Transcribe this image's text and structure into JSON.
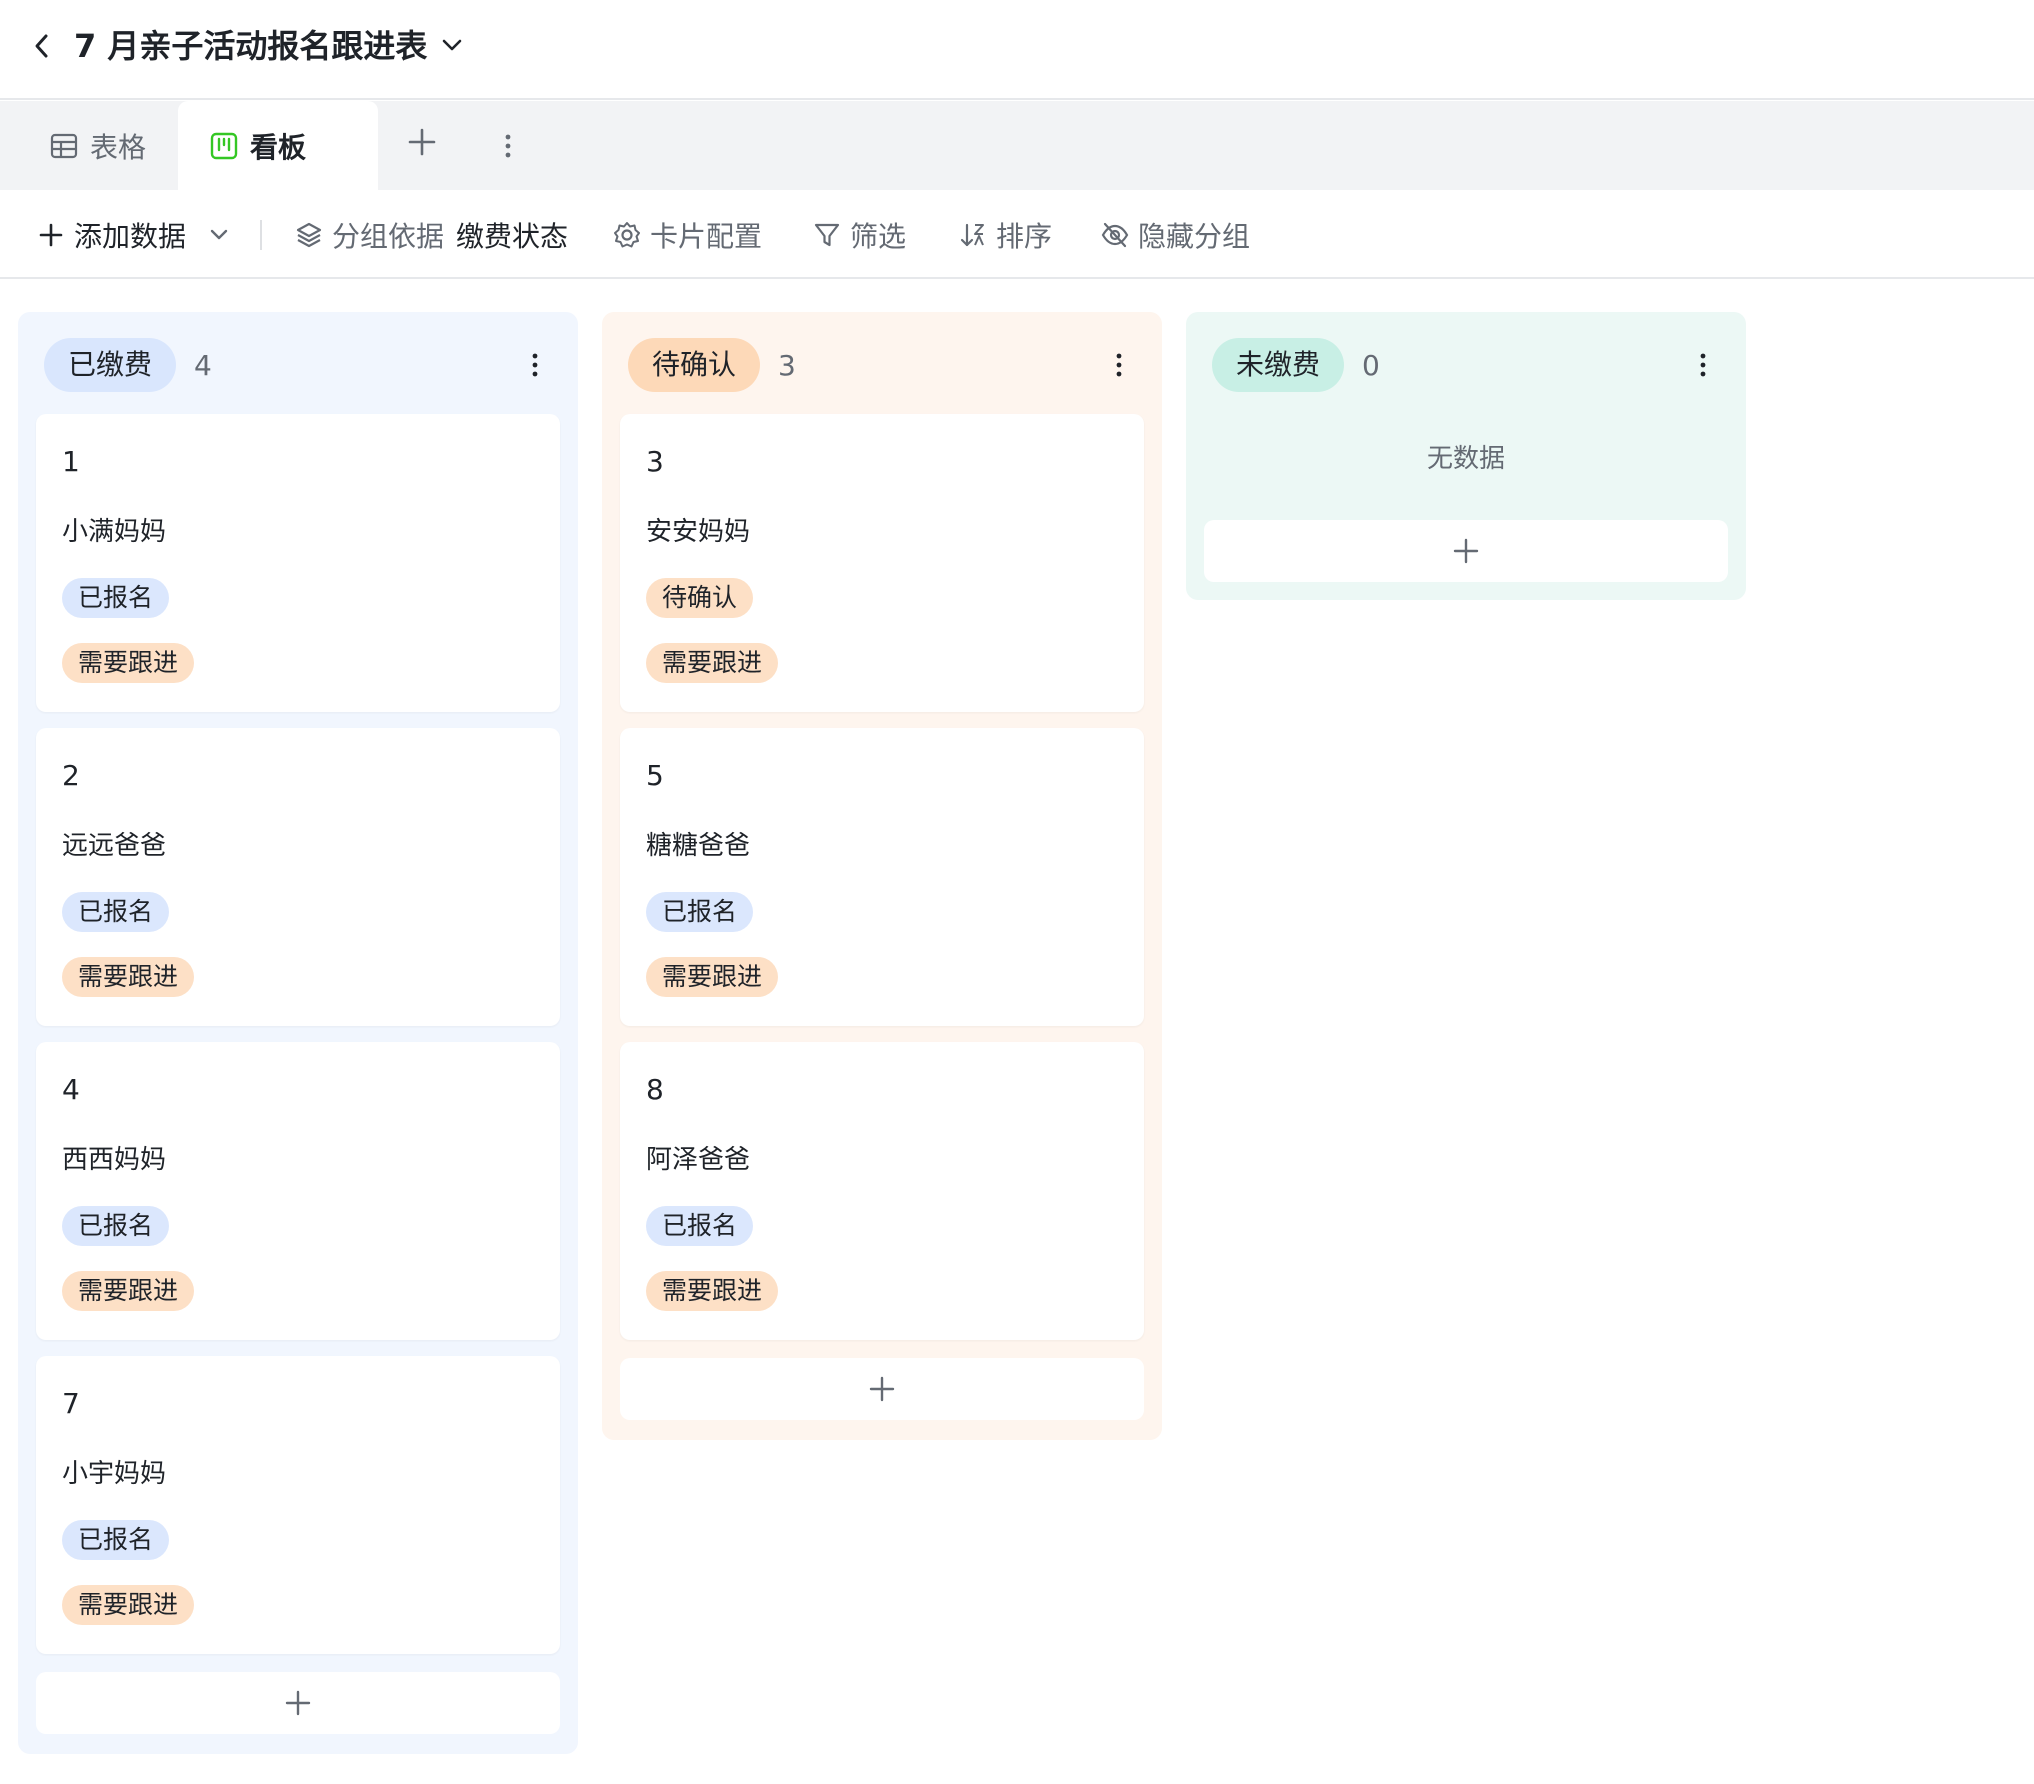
{
  "header": {
    "title": "7 月亲子活动报名跟进表"
  },
  "tabs": [
    {
      "label": "表格",
      "icon": "table-icon"
    },
    {
      "label": "看板",
      "icon": "kanban-icon"
    }
  ],
  "toolbar": {
    "add_label": "添加数据",
    "group_label": "分组依据",
    "group_field": "缴费状态",
    "card_config_label": "卡片配置",
    "filter_label": "筛选",
    "sort_label": "排序",
    "hide_group_label": "隐藏分组"
  },
  "colors": {
    "paid_bg": "#f1f6fe",
    "pending_bg": "#fef5ee",
    "unpaid_bg": "#ecf8f5",
    "tag_blue": "#dbe7fd",
    "tag_orange": "#fde0c6",
    "kanban_green": "#34c724"
  },
  "columns": [
    {
      "label": "已缴费",
      "count": "4",
      "cards": [
        {
          "id": "1",
          "name": "小满妈妈",
          "status": "已报名",
          "follow": "需要跟进"
        },
        {
          "id": "2",
          "name": "远远爸爸",
          "status": "已报名",
          "follow": "需要跟进"
        },
        {
          "id": "4",
          "name": "西西妈妈",
          "status": "已报名",
          "follow": "需要跟进"
        },
        {
          "id": "7",
          "name": "小宇妈妈",
          "status": "已报名",
          "follow": "需要跟进"
        }
      ]
    },
    {
      "label": "待确认",
      "count": "3",
      "cards": [
        {
          "id": "3",
          "name": "安安妈妈",
          "status": "待确认",
          "follow": "需要跟进"
        },
        {
          "id": "5",
          "name": "糖糖爸爸",
          "status": "已报名",
          "follow": "需要跟进"
        },
        {
          "id": "8",
          "name": "阿泽爸爸",
          "status": "已报名",
          "follow": "需要跟进"
        }
      ]
    },
    {
      "label": "未缴费",
      "count": "0",
      "empty_text": "无数据",
      "cards": []
    }
  ]
}
